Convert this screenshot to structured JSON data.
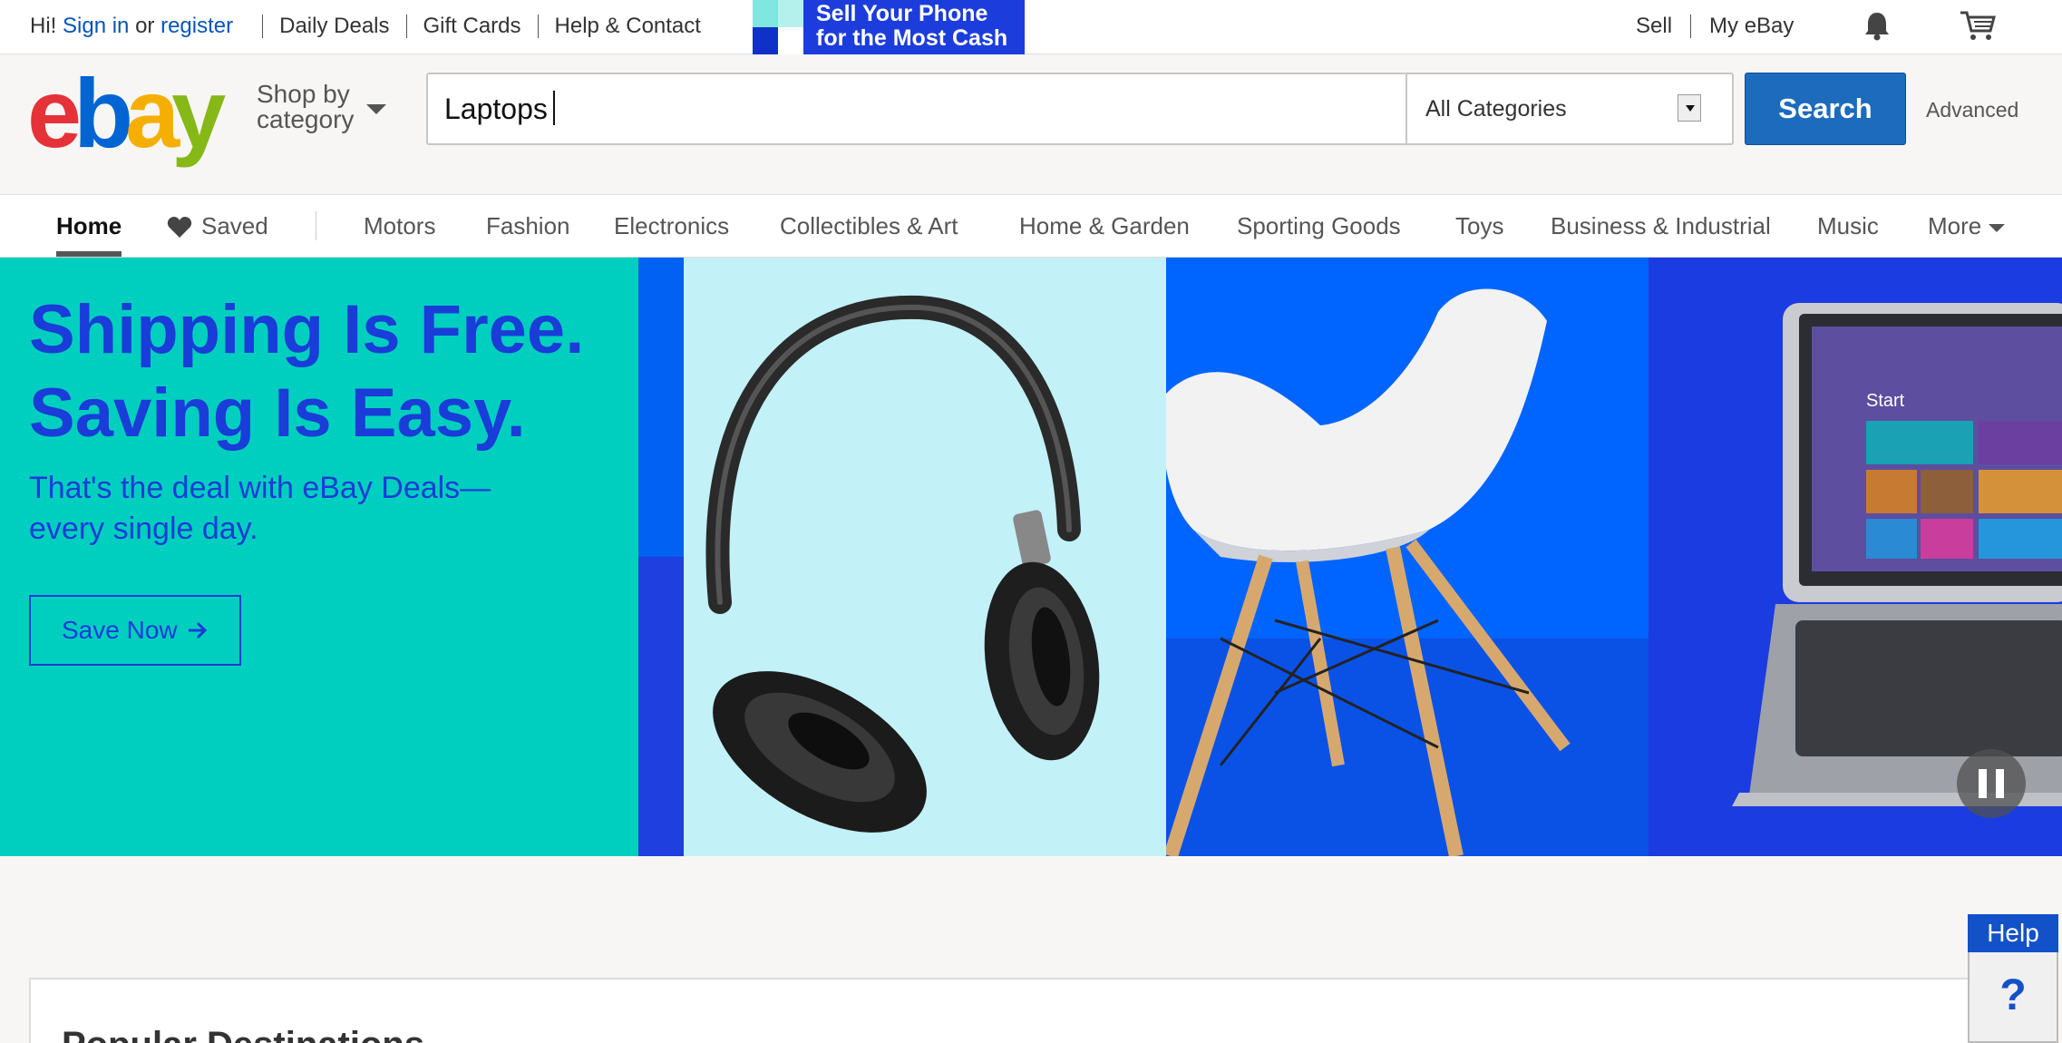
{
  "topbar": {
    "greeting": "Hi!",
    "sign_in": "Sign in",
    "or": "or",
    "register": "register",
    "links": [
      "Daily Deals",
      "Gift Cards",
      "Help & Contact"
    ],
    "promo_line1": "Sell Your Phone",
    "promo_line2": "for the Most Cash",
    "sell": "Sell",
    "my_ebay": "My eBay"
  },
  "header": {
    "logo": {
      "e": "e",
      "b": "b",
      "a": "a",
      "y": "y"
    },
    "shop_by_line1": "Shop by",
    "shop_by_line2": "category",
    "search_value": "Laptops",
    "category": "All Categories",
    "search_button": "Search",
    "advanced": "Advanced"
  },
  "nav": {
    "home": "Home",
    "saved": "Saved",
    "items": [
      "Motors",
      "Fashion",
      "Electronics",
      "Collectibles & Art",
      "Home & Garden",
      "Sporting Goods",
      "Toys",
      "Business & Industrial",
      "Music"
    ],
    "more": "More"
  },
  "hero": {
    "title_line1": "Shipping Is Free.",
    "title_line2": "Saving Is Easy.",
    "subtitle_line1": "That's the deal with eBay Deals—",
    "subtitle_line2": "every single day.",
    "cta": "Save Now",
    "laptop_screen": {
      "start": "Start"
    }
  },
  "popular": {
    "title": "Popular Destinations"
  },
  "help": {
    "label": "Help",
    "icon": "?"
  },
  "colors": {
    "accent": "#1c6bbc",
    "hero_bg": "#00cfbf",
    "hero_text": "#1a3cd8"
  }
}
